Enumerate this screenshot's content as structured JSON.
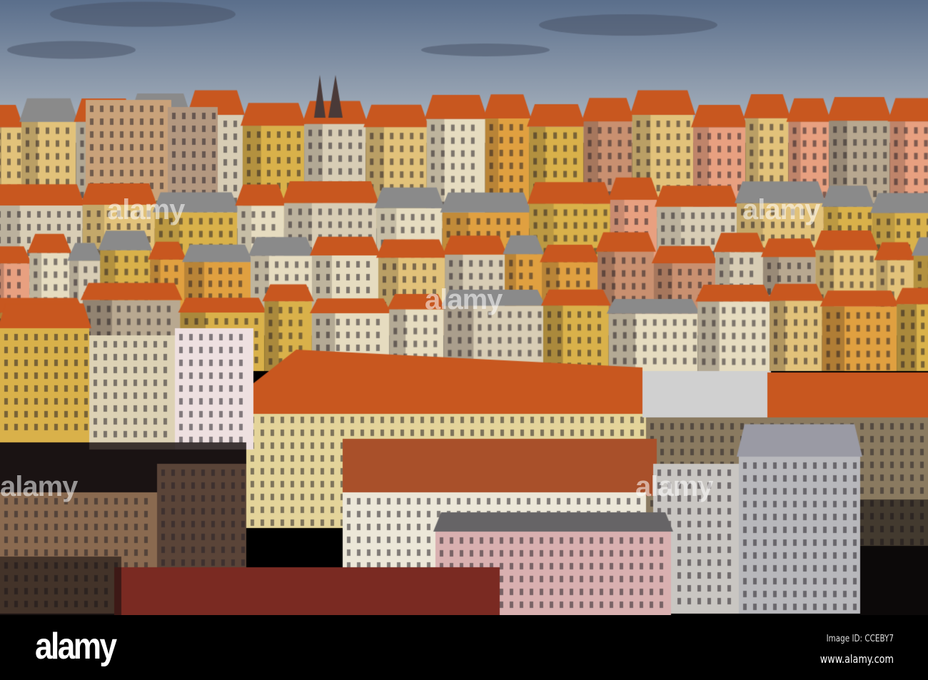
{
  "photo": {
    "subject": "Rooftops of apartment buildings at sunset",
    "palette": {
      "sky_top": "#5b6f8c",
      "sky_bottom": "#aab4bf",
      "roof": "#c8571f",
      "facade_yellow": "#d9b14a",
      "facade_cream": "#e6dcc0",
      "shadow": "#3a2f2c"
    }
  },
  "watermark": {
    "text": "alamy"
  },
  "footer": {
    "logo": "alamy",
    "image_id": "Image ID: CCEBY7",
    "website": "www.alamy.com"
  }
}
